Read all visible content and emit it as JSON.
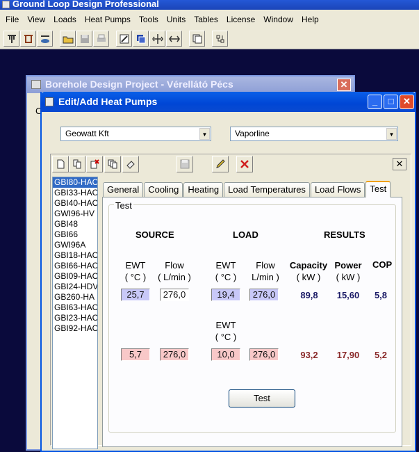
{
  "app": {
    "title": "Ground Loop Design Professional"
  },
  "menu": [
    "File",
    "View",
    "Loads",
    "Heat Pumps",
    "Tools",
    "Units",
    "Tables",
    "License",
    "Window",
    "Help"
  ],
  "toolbar": {
    "icons": [
      "borehole-icon",
      "horizontal-icon",
      "pond-icon",
      "open-icon",
      "save-icon",
      "print-icon",
      "edit-icon",
      "copy-window-icon",
      "tile-vertical-icon",
      "tile-horizontal-icon",
      "window-icon",
      "network-icon"
    ]
  },
  "bg_window": {
    "title": "Borehole Design Project - Vérellátó Pécs",
    "partial_label": "C",
    "close_glyph": "✕"
  },
  "dialog": {
    "title": "Edit/Add Heat Pumps",
    "manufacturer": "Geowatt Kft",
    "series": "Vaporline",
    "close_glyph": "✕"
  },
  "pumps": [
    "GBI80-HAC",
    "GBI33-HAC",
    "GBI40-HAC",
    "GWI96-HV",
    "GBI48",
    "GBI66",
    "GWI96A",
    "GBI18-HAC",
    "GBI66-HAC",
    "GBI09-HAC",
    "GBI24-HDV",
    "GB260-HA",
    "GBI63-HAC",
    "GBI23-HAC",
    "GBI92-HAC"
  ],
  "tabs": [
    "General",
    "Cooling",
    "Heating",
    "Load Temperatures",
    "Load Flows",
    "Test"
  ],
  "test": {
    "group_label": "Test",
    "source_header": "SOURCE",
    "load_header": "LOAD",
    "results_header": "RESULTS",
    "ewt_label": "EWT",
    "ewt_unit": "( °C )",
    "flow_label": "Flow",
    "flow_unit": "( L/min )",
    "load_flow_unit": "L/min )",
    "capacity_label": "Capacity",
    "capacity_unit": "( kW )",
    "power_label": "Power",
    "power_unit": "( kW )",
    "cop_label": "COP",
    "cooling": {
      "source_ewt": "25,7",
      "source_flow": "276,0",
      "load_ewt": "19,4",
      "load_flow": "276,0",
      "capacity": "89,8",
      "power": "15,60",
      "cop": "5,8"
    },
    "heating": {
      "source_ewt": "5,7",
      "source_flow": "276,0",
      "load_ewt": "10,0",
      "load_flow": "276,0",
      "capacity": "93,2",
      "power": "17,90",
      "cop": "5,2"
    },
    "button_label": "Test"
  }
}
